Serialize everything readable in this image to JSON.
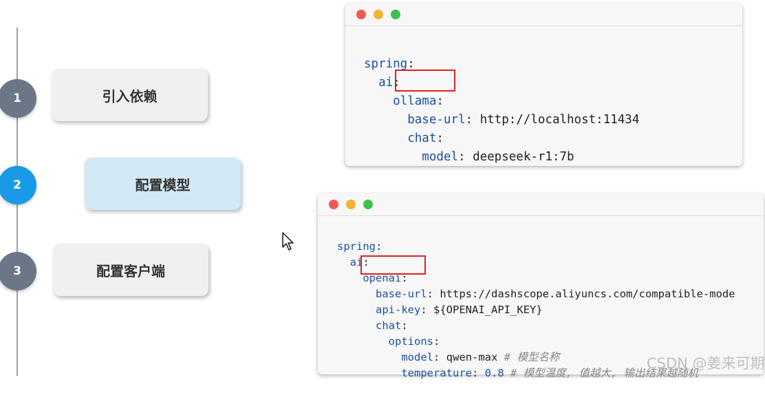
{
  "steps": [
    {
      "number": "1",
      "label": "引入依赖",
      "color": "#6b7686"
    },
    {
      "number": "2",
      "label": "配置模型",
      "color": "#1a9ae6"
    },
    {
      "number": "3",
      "label": "配置客户端",
      "color": "#6b7686"
    }
  ],
  "highlight_card_color": "#d3e9f5",
  "window_dots": {
    "red": "#ee5b55",
    "yellow": "#f2b233",
    "green": "#3dc14b"
  },
  "ollama_code": {
    "l1_key": "spring",
    "l2_key": "ai",
    "l3_key": "ollama",
    "l4_key": "base-url",
    "l4_val": "http://localhost:11434",
    "l5_key": "chat",
    "l6_key": "model",
    "l6_val": "deepseek-r1:7b"
  },
  "openai_code": {
    "l1_key": "spring",
    "l2_key": "ai",
    "l3_key": "openai",
    "l4_key": "base-url",
    "l4_val": "https://dashscope.aliyuncs.com/compatible-mode",
    "l5_key": "api-key",
    "l5_val": "${OPENAI_API_KEY}",
    "l6_key": "chat",
    "l7_key": "options",
    "l8_key": "model",
    "l8_val": "qwen-max",
    "l8_comment": "# 模型名称",
    "l9_key": "temperature",
    "l9_val": "0.8",
    "l9_comment": "# 模型温度, 值越大, 输出结果越随机"
  },
  "watermark": "CSDN @姜来可期"
}
